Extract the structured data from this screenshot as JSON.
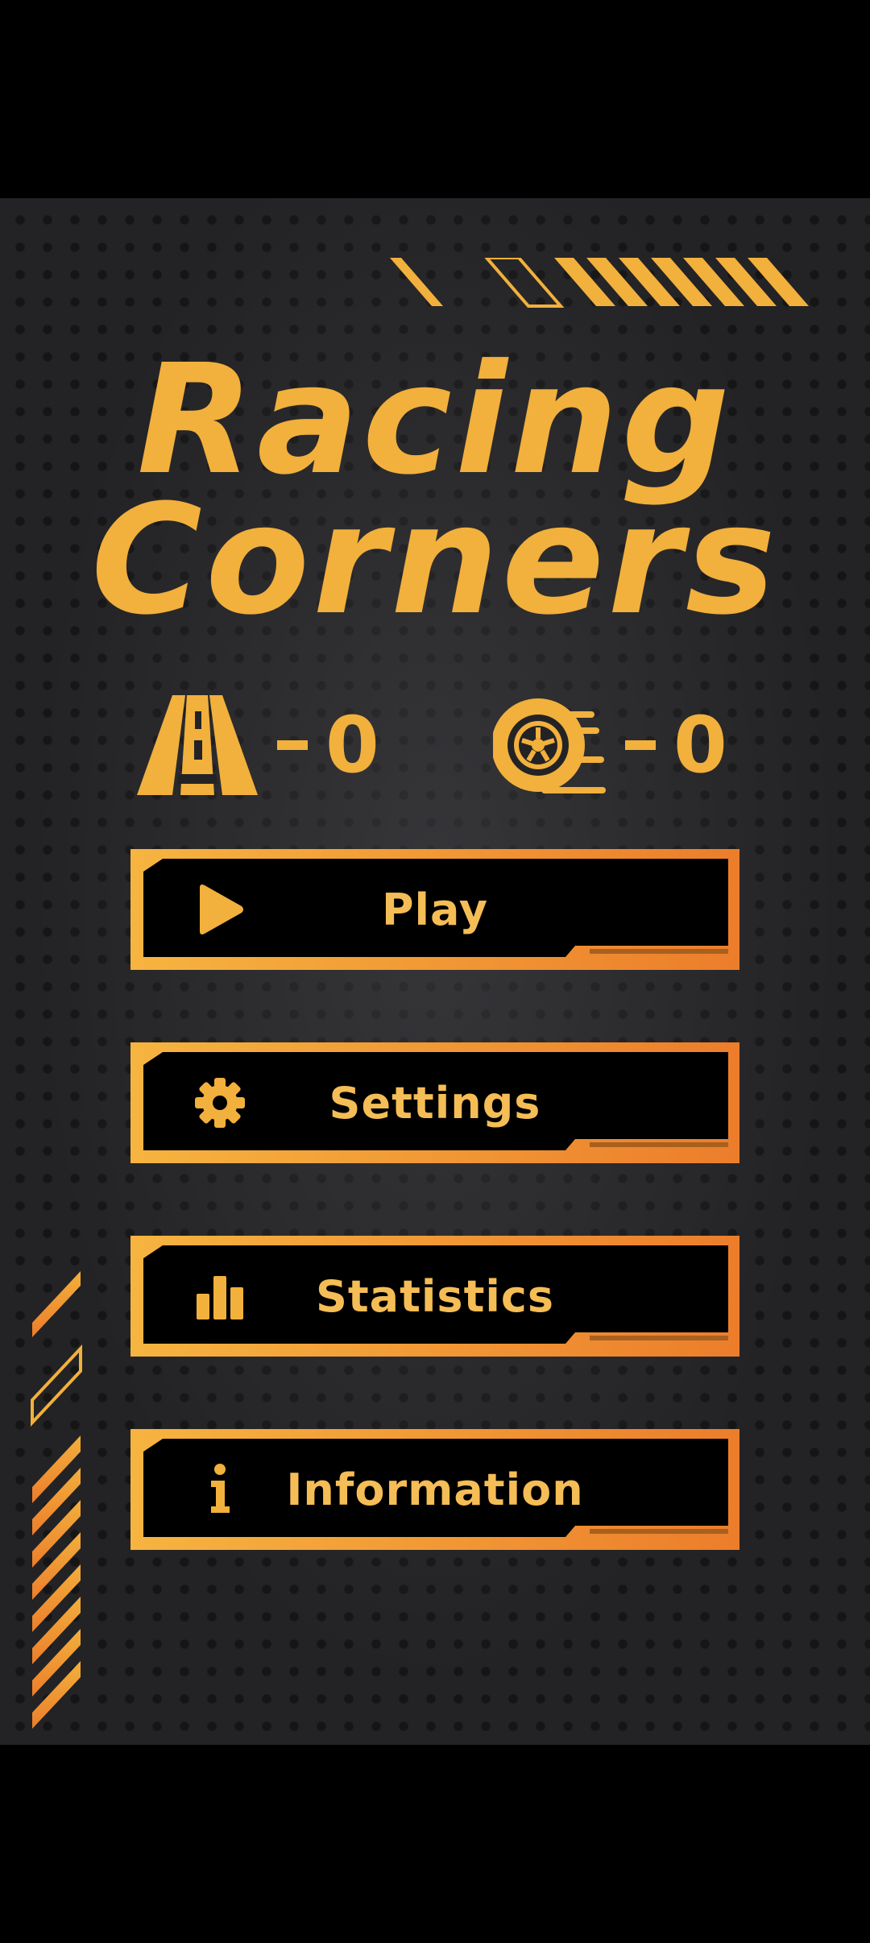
{
  "title": {
    "line1": "Racing",
    "line2": "Corners"
  },
  "stats": {
    "road": {
      "icon": "road-icon",
      "value": "0"
    },
    "wheel": {
      "icon": "wheel-icon",
      "value": "0"
    }
  },
  "menu": {
    "play": {
      "label": "Play",
      "icon": "play-icon"
    },
    "settings": {
      "label": "Settings",
      "icon": "gear-icon"
    },
    "statistics": {
      "label": "Statistics",
      "icon": "bar-chart-icon"
    },
    "information": {
      "label": "Information",
      "icon": "info-icon"
    }
  },
  "colors": {
    "accent": "#f2b03c",
    "accent_dark": "#ec7f2c",
    "background": "#232325",
    "button_fill": "#000000"
  }
}
